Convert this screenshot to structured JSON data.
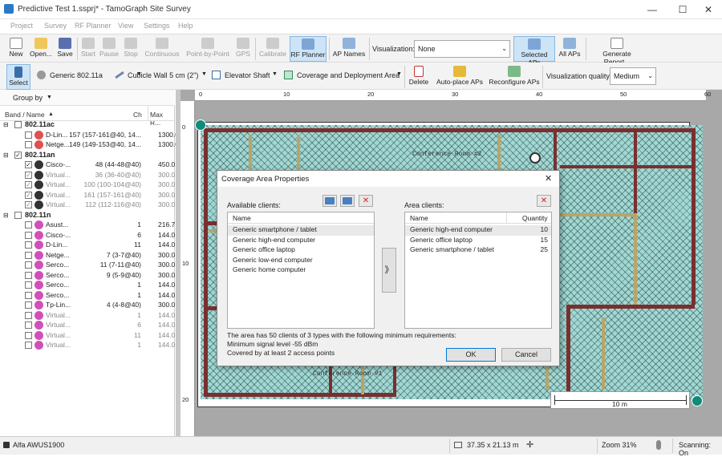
{
  "window": {
    "title": "Predictive Test 1.ssprj* - TamoGraph Site Survey",
    "minimize": "—",
    "maximize": "☐",
    "close": "✕"
  },
  "menu": [
    "Project",
    "Survey",
    "RF Planner",
    "View",
    "Settings",
    "Help"
  ],
  "toolbar1": {
    "new": "New",
    "open": "Open...",
    "save": "Save",
    "start": "Start",
    "pause": "Pause",
    "stop": "Stop",
    "continuous": "Continuous",
    "point_by_point": "Point-by-Point",
    "gps": "GPS",
    "calibrate": "Calibrate",
    "rf_planner": "RF Planner",
    "ap_names": "AP Names",
    "visualization_label": "Visualization:",
    "visualization_value": "None",
    "selected_aps": "Selected APs",
    "all_aps": "All APs",
    "generate_report": "Generate Report..."
  },
  "toolbar2": {
    "select": "Select",
    "ap_model": "Generic 802.11a",
    "wall": "Cubicle Wall 5 cm (2\")",
    "elevator": "Elevator Shaft",
    "coverage": "Coverage and Deployment Area",
    "delete": "Delete",
    "autoplace": "Auto-place APs",
    "reconfigure": "Reconfigure APs",
    "vq_label": "Visualization quality:",
    "vq_value": "Medium"
  },
  "left_panel": {
    "group_by": "Group by",
    "columns": {
      "name": "Band / Name",
      "ch": "Ch",
      "max": "Max R..."
    },
    "groups": [
      {
        "band": "802.11ac",
        "checked": false,
        "items": [
          {
            "name": "D-Lin...",
            "ch": "157 (157-161@40, 14...",
            "max": "1300.0",
            "checked": false,
            "virtual": false,
            "color": "#e05050"
          },
          {
            "name": "Netge...",
            "ch": "149 (149-153@40, 14...",
            "max": "1300.0",
            "checked": false,
            "virtual": false,
            "color": "#e05050"
          }
        ]
      },
      {
        "band": "802.11an",
        "checked": true,
        "items": [
          {
            "name": "Cisco-...",
            "ch": "48 (44-48@40)",
            "max": "450.0",
            "checked": true,
            "virtual": false,
            "color": "#333333"
          },
          {
            "name": "Virtual...",
            "ch": "36 (36-40@40)",
            "max": "300.0",
            "checked": true,
            "virtual": true,
            "color": "#333333"
          },
          {
            "name": "Virtual...",
            "ch": "100 (100-104@40)",
            "max": "300.0",
            "checked": true,
            "virtual": true,
            "color": "#333333"
          },
          {
            "name": "Virtual...",
            "ch": "161 (157-161@40)",
            "max": "300.0",
            "checked": true,
            "virtual": true,
            "color": "#333333"
          },
          {
            "name": "Virtual...",
            "ch": "112 (112-116@40)",
            "max": "300.0",
            "checked": true,
            "virtual": true,
            "color": "#333333"
          }
        ]
      },
      {
        "band": "802.11n",
        "checked": false,
        "items": [
          {
            "name": "Asust...",
            "ch": "1",
            "max": "216.7",
            "checked": false,
            "virtual": false,
            "color": "#d24fb8"
          },
          {
            "name": "Cisco-...",
            "ch": "6",
            "max": "144.0",
            "checked": false,
            "virtual": false,
            "color": "#d24fb8"
          },
          {
            "name": "D-Lin...",
            "ch": "11",
            "max": "144.0",
            "checked": false,
            "virtual": false,
            "color": "#d24fb8"
          },
          {
            "name": "Netge...",
            "ch": "7 (3-7@40)",
            "max": "300.0",
            "checked": false,
            "virtual": false,
            "color": "#d24fb8"
          },
          {
            "name": "Serco...",
            "ch": "11 (7-11@40)",
            "max": "300.0",
            "checked": false,
            "virtual": false,
            "color": "#d24fb8"
          },
          {
            "name": "Serco...",
            "ch": "9 (5-9@40)",
            "max": "300.0",
            "checked": false,
            "virtual": false,
            "color": "#d24fb8"
          },
          {
            "name": "Serco...",
            "ch": "1",
            "max": "144.0",
            "checked": false,
            "virtual": false,
            "color": "#d24fb8"
          },
          {
            "name": "Serco...",
            "ch": "1",
            "max": "144.0",
            "checked": false,
            "virtual": false,
            "color": "#d24fb8"
          },
          {
            "name": "Tp-Lin...",
            "ch": "4 (4-8@40)",
            "max": "300.0",
            "checked": false,
            "virtual": false,
            "color": "#d24fb8"
          },
          {
            "name": "Virtual...",
            "ch": "1",
            "max": "144.0",
            "checked": false,
            "virtual": true,
            "color": "#d24fb8"
          },
          {
            "name": "Virtual...",
            "ch": "6",
            "max": "144.0",
            "checked": false,
            "virtual": true,
            "color": "#d24fb8"
          },
          {
            "name": "Virtual...",
            "ch": "11",
            "max": "144.0",
            "checked": false,
            "virtual": true,
            "color": "#d24fb8"
          },
          {
            "name": "Virtual...",
            "ch": "1",
            "max": "144.0",
            "checked": false,
            "virtual": true,
            "color": "#d24fb8"
          }
        ]
      }
    ]
  },
  "plan": {
    "rulers_h": [
      "0",
      "10",
      "20",
      "30",
      "40",
      "50",
      "60"
    ],
    "rulers_v": [
      "0",
      "10",
      "20"
    ],
    "room_labels": [
      "Conference Room #2",
      "Conference Room #1"
    ],
    "scale": "10 m"
  },
  "dialog": {
    "title": "Coverage Area Properties",
    "available_label": "Available clients:",
    "area_label": "Area clients:",
    "name_col": "Name",
    "qty_col": "Quantity",
    "available": [
      "Generic smartphone / tablet",
      "Generic high-end computer",
      "Generic office laptop",
      "Generic low-end computer",
      "Generic home computer"
    ],
    "area": [
      {
        "name": "Generic high-end computer",
        "qty": "10"
      },
      {
        "name": "Generic office laptop",
        "qty": "15"
      },
      {
        "name": "Generic smartphone / tablet",
        "qty": "25"
      }
    ],
    "summary1": "The area has 50 clients of 3 types with the following minimum requirements:",
    "summary2": "Minimum signal level -55 dBm",
    "summary3": "Covered by at least 2 access points",
    "ok": "OK",
    "cancel": "Cancel",
    "move": "》",
    "close": "✕"
  },
  "status": {
    "adapter": "Alfa AWUS1900",
    "coords": "37.35 x 21.13 m",
    "zoom": "Zoom 31%",
    "scanning": "Scanning: On"
  }
}
